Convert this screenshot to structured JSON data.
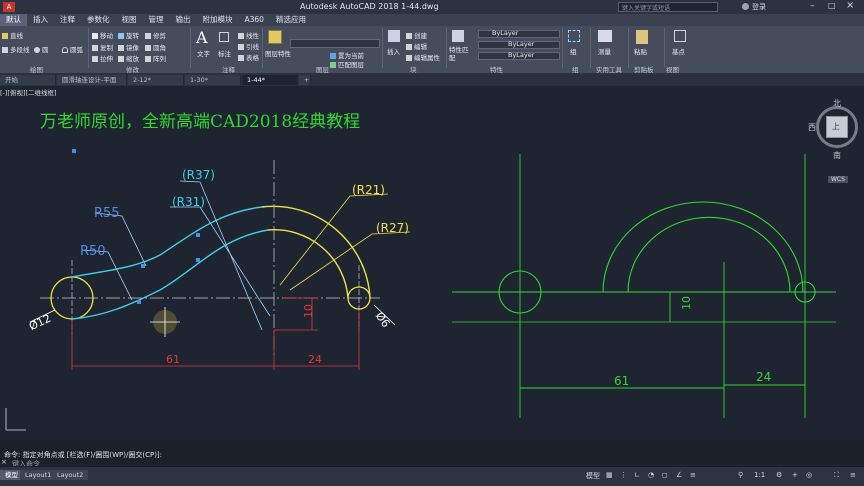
{
  "window": {
    "title": "Autodesk AutoCAD 2018     1-44.dwg",
    "search_placeholder": "键入关键字或短语",
    "user_label": "登录"
  },
  "menu": [
    "默认",
    "插入",
    "注释",
    "参数化",
    "视图",
    "管理",
    "输出",
    "附加模块",
    "A360",
    "精选应用"
  ],
  "ribbon": {
    "draw": [
      "直线",
      "多段线",
      "圆",
      "圆弧"
    ],
    "modify": [
      "移动",
      "旋转",
      "修剪",
      "复制",
      "镜像",
      "圆角",
      "拉伸",
      "缩放",
      "阵列"
    ],
    "annotation": [
      "文字",
      "标注",
      "线性",
      "引线",
      "表格"
    ],
    "layers": [
      "图层特性",
      "置为当前",
      "匹配图层"
    ],
    "block": [
      "插入",
      "创建",
      "编辑",
      "编辑属性"
    ],
    "properties": [
      "特性匹配",
      "ByLayer",
      "ByLayer",
      "ByLayer"
    ],
    "utilities": [
      "组",
      "测量",
      "粘贴",
      "基点"
    ],
    "groups": [
      "绘图",
      "修改",
      "注释",
      "图层",
      "块",
      "特性",
      "组",
      "实用工具",
      "剪贴板",
      "视图"
    ]
  },
  "file_tabs": [
    "开始",
    "圆滑轴连设计-平面",
    "2-12*",
    "1-30*",
    "1-44*"
  ],
  "view_label": "[-][俯视][二维线框]",
  "drawing": {
    "title": "万老师原创，全新高端CAD2018经典教程",
    "dims_left": [
      "(R37)",
      "(R31)",
      "(R21)",
      "(R27)",
      "R55",
      "R50",
      "Ø12",
      "Ø6",
      "10",
      "61",
      "24"
    ],
    "dims_right": [
      "10",
      "61",
      "24"
    ]
  },
  "viewcube": {
    "north": "北",
    "west": "西",
    "top": "上",
    "south": "南",
    "wcs": "WCS"
  },
  "command": {
    "history": "命令: 指定对角点或 [栏选(F)/圈围(WP)/圈交(CP)]:",
    "prompt": "键入命令"
  },
  "layout_tabs": [
    "模型",
    "Layout1",
    "Layout2"
  ],
  "status": {
    "model": "模型",
    "scale": "1:1"
  },
  "colors": {
    "green": "#33d633",
    "cyan": "#3fd0e6",
    "yellow": "#f0e24a",
    "red": "#e03a3a",
    "blue": "#4d8fe8"
  }
}
